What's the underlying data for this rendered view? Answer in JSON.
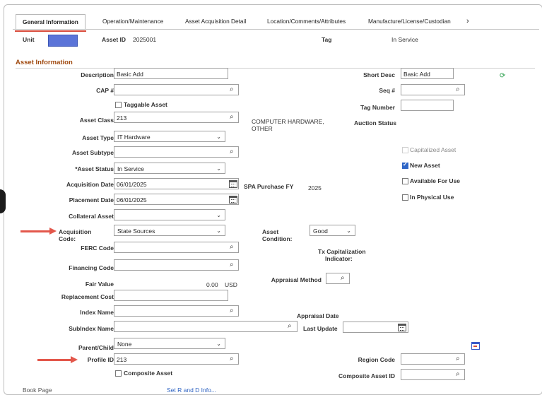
{
  "tabs": [
    {
      "label": "General Information",
      "active": true
    },
    {
      "label": "Operation/Maintenance",
      "active": false
    },
    {
      "label": "Asset Acquisition Detail",
      "active": false
    },
    {
      "label": "Location/Comments/Attributes",
      "active": false
    },
    {
      "label": "Manufacture/License/Custodian",
      "active": false
    }
  ],
  "tabs_more": "›",
  "header": {
    "unit_label": "Unit",
    "asset_id_label": "Asset ID",
    "asset_id_value": "2025001",
    "tag_label": "Tag",
    "status_text": "In Service"
  },
  "section_title": "Asset Information",
  "fields": {
    "description": {
      "label": "Description",
      "value": "Basic Add"
    },
    "short_desc": {
      "label": "Short Desc",
      "value": "Basic Add"
    },
    "cap": {
      "label": "CAP #",
      "value": ""
    },
    "seq": {
      "label": "Seq #",
      "value": ""
    },
    "taggable": {
      "label": "Taggable Asset",
      "checked": false
    },
    "tag_number": {
      "label": "Tag Number",
      "value": ""
    },
    "asset_class": {
      "label": "Asset Class",
      "value": "213",
      "desc": "COMPUTER HARDWARE, OTHER"
    },
    "auction_status": {
      "label": "Auction Status"
    },
    "asset_type": {
      "label": "Asset Type",
      "value": "IT Hardware"
    },
    "asset_subtype": {
      "label": "Asset Subtype",
      "value": ""
    },
    "capitalized": {
      "label": "Capitalized Asset",
      "checked": false
    },
    "asset_status": {
      "label": "*Asset Status",
      "value": "In Service"
    },
    "new_asset": {
      "label": "New Asset",
      "checked": true
    },
    "acq_date": {
      "label": "Acquisition Date",
      "value": "06/01/2025"
    },
    "spa_purchase_fy": {
      "label": "SPA Purchase FY",
      "value": "2025"
    },
    "available_for_use": {
      "label": "Available For Use",
      "checked": false
    },
    "placement_date": {
      "label": "Placement Date",
      "value": "06/01/2025"
    },
    "in_physical_use": {
      "label": "In Physical Use",
      "checked": false
    },
    "collateral_asset": {
      "label": "Collateral Asset",
      "value": ""
    },
    "acquisition_code": {
      "label1": "Acquisition",
      "label2": "Code:",
      "value": "State Sources"
    },
    "asset_condition": {
      "label1": "Asset",
      "label2": "Condition:",
      "value": "Good"
    },
    "ferc_code": {
      "label": "FERC Code",
      "value": ""
    },
    "tx_cap": {
      "label1": "Tx Capitalization",
      "label2": "Indicator:"
    },
    "financing_code": {
      "label": "Financing Code",
      "value": ""
    },
    "fair_value": {
      "label": "Fair Value",
      "value": "0.00",
      "currency": "USD"
    },
    "appraisal_method": {
      "label": "Appraisal Method",
      "value": ""
    },
    "replacement_cost": {
      "label": "Replacement Cost",
      "value": ""
    },
    "index_name": {
      "label": "Index Name",
      "value": ""
    },
    "appraisal_date": {
      "label": "Appraisal Date"
    },
    "subindex_name": {
      "label": "SubIndex Name",
      "value": ""
    },
    "last_update": {
      "label": "Last Update",
      "value": ""
    },
    "parent_child": {
      "label": "Parent/Child",
      "value": "None"
    },
    "profile_id": {
      "label": "Profile ID",
      "value": "213"
    },
    "region_code": {
      "label": "Region Code",
      "value": ""
    },
    "composite_asset": {
      "label": "Composite Asset",
      "checked": false
    },
    "composite_asset_id": {
      "label": "Composite Asset ID",
      "value": ""
    }
  },
  "footer": {
    "book_page": "Book Page",
    "set_rd": "Set R and D Info..."
  },
  "icons": {
    "search": "🔍",
    "chevron": "⌄"
  },
  "colors": {
    "accent_red": "#e3574b",
    "section_title": "#a04a10",
    "unit_fill": "#5b74d8",
    "link": "#2d62c2"
  }
}
